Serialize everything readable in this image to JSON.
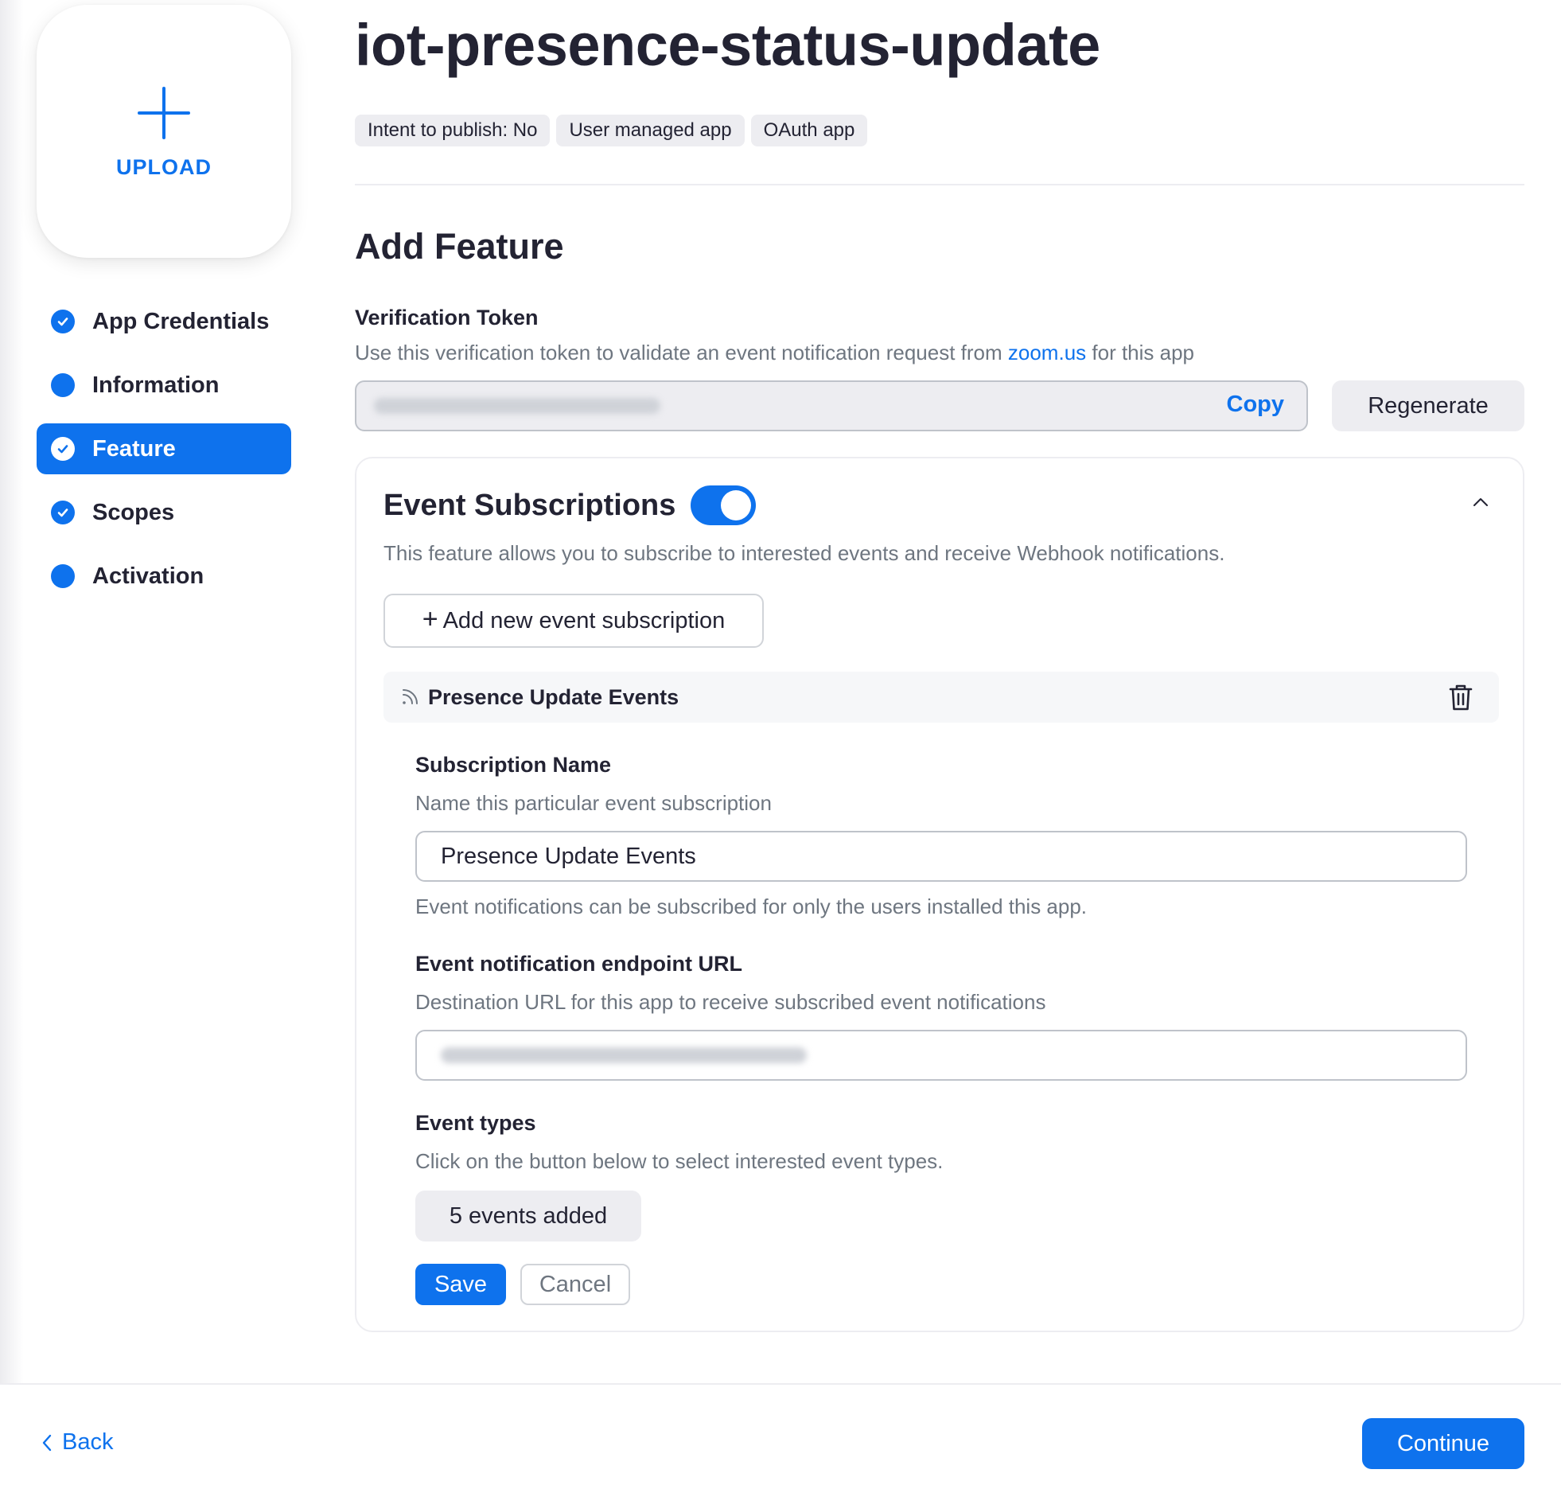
{
  "upload": {
    "label": "UPLOAD"
  },
  "sidebar": {
    "items": [
      {
        "label": "App Credentials",
        "state": "done"
      },
      {
        "label": "Information",
        "state": "pending"
      },
      {
        "label": "Feature",
        "state": "done-active"
      },
      {
        "label": "Scopes",
        "state": "done"
      },
      {
        "label": "Activation",
        "state": "pending"
      }
    ]
  },
  "header": {
    "title": "iot-presence-status-update",
    "tags": [
      "Intent to publish: No",
      "User managed app",
      "OAuth app"
    ]
  },
  "main": {
    "heading": "Add Feature",
    "verification": {
      "label": "Verification Token",
      "desc_before": "Use this verification token to validate an event notification request from ",
      "desc_link": "zoom.us",
      "desc_after": " for this app",
      "copy_label": "Copy",
      "regenerate_label": "Regenerate"
    },
    "event_subscriptions": {
      "title": "Event Subscriptions",
      "enabled": true,
      "description": "This feature allows you to subscribe to interested events and receive Webhook notifications.",
      "add_button": "Add new event subscription",
      "subscription": {
        "header_name": "Presence Update Events",
        "name_label": "Subscription Name",
        "name_desc": "Name this particular event subscription",
        "name_value": "Presence Update Events",
        "name_note": "Event notifications can be subscribed for only the users installed this app.",
        "url_label": "Event notification endpoint URL",
        "url_desc": "Destination URL for this app to receive subscribed event notifications",
        "types_label": "Event types",
        "types_desc": "Click on the button below to select interested event types.",
        "types_button": "5 events added",
        "save_label": "Save",
        "cancel_label": "Cancel"
      }
    }
  },
  "footer": {
    "back_label": "Back",
    "continue_label": "Continue"
  },
  "colors": {
    "accent": "#0e72ed",
    "text": "#232333",
    "muted": "#6e7680",
    "chip": "#ededf1"
  }
}
